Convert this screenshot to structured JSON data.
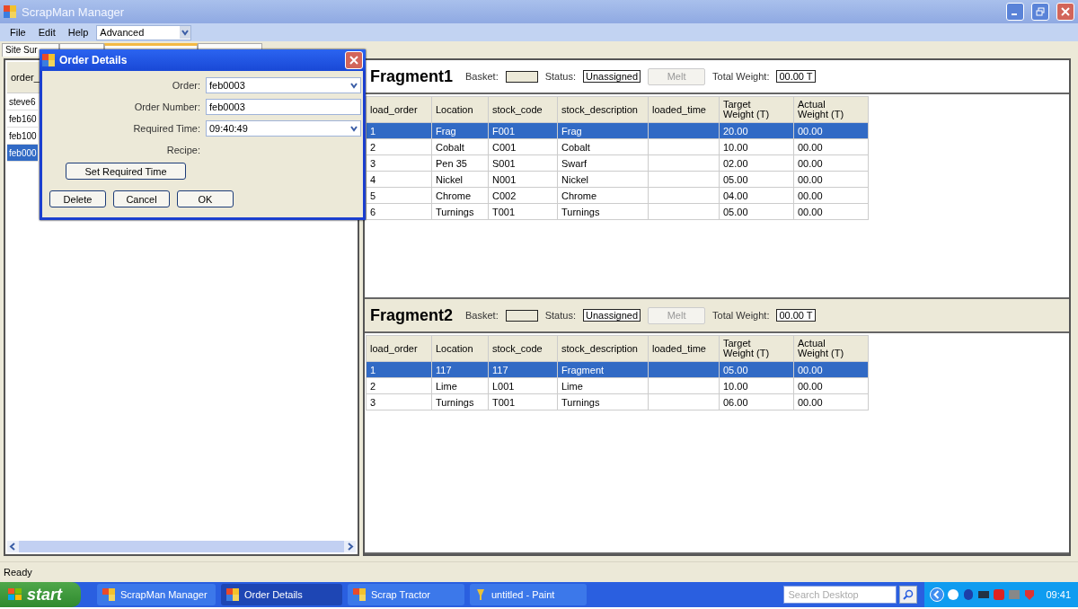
{
  "window": {
    "title": "ScrapMan Manager"
  },
  "menu": [
    "File",
    "Edit",
    "Help"
  ],
  "mode_combo": {
    "value": "Advanced"
  },
  "tabs": [
    {
      "label": "Site Sur",
      "selected": false
    },
    {
      "selected": false
    },
    {
      "selected": true
    },
    {
      "selected": false
    }
  ],
  "order_list": {
    "header": "order_",
    "rows": [
      {
        "text": "steve6",
        "selected": false
      },
      {
        "text": "feb160",
        "selected": false
      },
      {
        "text": "feb100",
        "selected": false
      },
      {
        "text": "feb000",
        "selected": true
      }
    ]
  },
  "dialog": {
    "title": "Order Details",
    "fields": [
      {
        "kind": "combo",
        "label": "Order:",
        "value": "feb0003"
      },
      {
        "kind": "text",
        "label": "Order Number:",
        "value": "feb0003"
      },
      {
        "kind": "combo",
        "label": "Required Time:",
        "value": "09:40:49"
      },
      {
        "kind": "label",
        "label": "Recipe:"
      }
    ],
    "set_time_button": "Set Required Time",
    "buttons": [
      "Delete",
      "Cancel",
      "OK"
    ]
  },
  "fragments": [
    {
      "title": "Fragment1",
      "basket_label": "Basket:",
      "status_label": "Status:",
      "status": "Unassigned",
      "melt_button": {
        "label": "Melt",
        "disabled": true
      },
      "weight_label": "Total Weight:",
      "total_weight": "00.00 T",
      "columns": [
        "load_order",
        "Location",
        "stock_code",
        "stock_description",
        "loaded_time",
        "Target\nWeight (T)",
        "Actual\nWeight (T)"
      ],
      "rows": [
        {
          "selected": true,
          "cells": [
            "1",
            "Frag",
            "F001",
            "Frag",
            "",
            "20.00",
            "00.00"
          ]
        },
        {
          "selected": false,
          "cells": [
            "2",
            "Cobalt",
            "C001",
            "Cobalt",
            "",
            "10.00",
            "00.00"
          ]
        },
        {
          "selected": false,
          "cells": [
            "3",
            "Pen 35",
            "S001",
            "Swarf",
            "",
            "02.00",
            "00.00"
          ]
        },
        {
          "selected": false,
          "cells": [
            "4",
            "Nickel",
            "N001",
            "Nickel",
            "",
            "05.00",
            "00.00"
          ]
        },
        {
          "selected": false,
          "cells": [
            "5",
            "Chrome",
            "C002",
            "Chrome",
            "",
            "04.00",
            "00.00"
          ]
        },
        {
          "selected": false,
          "cells": [
            "6",
            "Turnings",
            "T001",
            "Turnings",
            "",
            "05.00",
            "00.00"
          ]
        }
      ]
    },
    {
      "title": "Fragment2",
      "basket_label": "Basket:",
      "status_label": "Status:",
      "status": "Unassigned",
      "melt_button": {
        "label": "Melt",
        "disabled": true
      },
      "weight_label": "Total Weight:",
      "total_weight": "00.00 T",
      "columns": [
        "load_order",
        "Location",
        "stock_code",
        "stock_description",
        "loaded_time",
        "Target\nWeight (T)",
        "Actual\nWeight (T)"
      ],
      "rows": [
        {
          "selected": true,
          "cells": [
            "1",
            "117",
            "117",
            "Fragment",
            "",
            "05.00",
            "00.00"
          ]
        },
        {
          "selected": false,
          "cells": [
            "2",
            "Lime",
            "L001",
            "Lime",
            "",
            "10.00",
            "00.00"
          ]
        },
        {
          "selected": false,
          "cells": [
            "3",
            "Turnings",
            "T001",
            "Turnings",
            "",
            "06.00",
            "00.00"
          ]
        }
      ]
    }
  ],
  "status_bar": "Ready",
  "taskbar": {
    "start": "start",
    "items": [
      {
        "label": "ScrapMan Manager",
        "kind": "app",
        "selected": false
      },
      {
        "label": "Order Details",
        "kind": "app",
        "selected": true
      },
      {
        "label": "Scrap Tractor",
        "kind": "app",
        "selected": false
      },
      {
        "label": "untitled - Paint",
        "kind": "paint",
        "selected": false
      }
    ],
    "search_placeholder": "Search Desktop",
    "clock": "09:41"
  }
}
